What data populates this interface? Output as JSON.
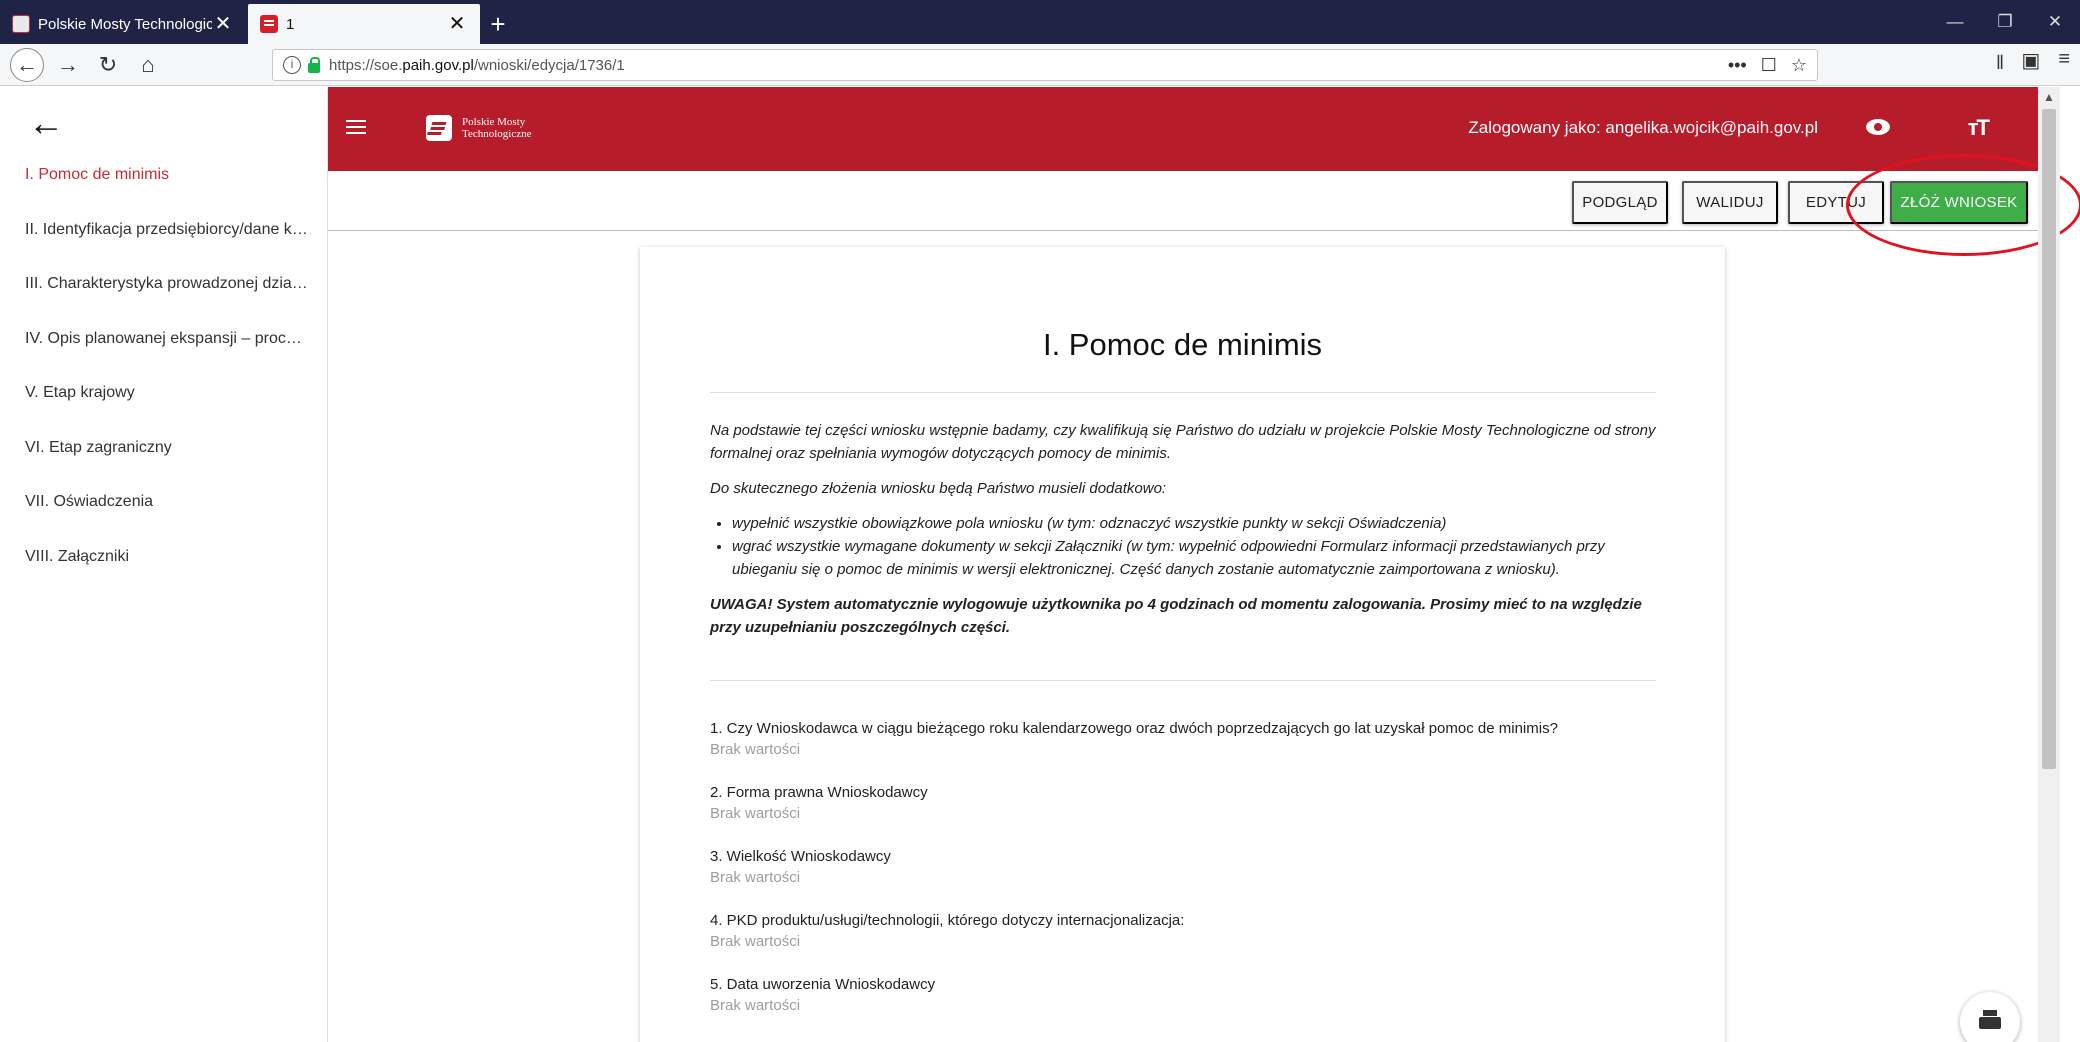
{
  "browser": {
    "tabs": [
      {
        "title": "Polskie Mosty Technologiczne |",
        "close": "✕"
      },
      {
        "title": "1",
        "close": "✕"
      }
    ],
    "new_tab": "+",
    "window_controls": [
      "—",
      "❐",
      "✕"
    ],
    "url_prefix": "https://soe.",
    "url_domain": "paih.gov.pl",
    "url_path": "/wnioski/edycja/1736/1",
    "url_actions": [
      "•••",
      "☐",
      "☆"
    ],
    "right_toolbar": [
      "𝍪",
      "▣",
      "≡"
    ]
  },
  "sidebar": {
    "back_icon": "←",
    "items": [
      {
        "label": "I. Pomoc de minimis"
      },
      {
        "label": "II. Identyfikacja przedsiębiorcy/dane kont..."
      },
      {
        "label": "III. Charakterystyka prowadzonej działaln..."
      },
      {
        "label": "IV. Opis planowanej ekspansji – proces in..."
      },
      {
        "label": "V. Etap krajowy"
      },
      {
        "label": "VI. Etap zagraniczny"
      },
      {
        "label": "VII. Oświadczenia"
      },
      {
        "label": "VIII. Załączniki"
      }
    ]
  },
  "header": {
    "logo_line1": "Polskie Mosty",
    "logo_line2": "Technologiczne",
    "user": "Zalogowany jako: angelika.wojcik@paih.gov.pl",
    "textsize_glyph": "тT",
    "brand_color": "#b71c2b"
  },
  "toolbar": {
    "preview": "PODGLĄD",
    "validate": "WALIDUJ",
    "edit": "EDYTUJ",
    "submit": "ZŁÓŻ WNIOSEK",
    "submit_color": "#3fae49"
  },
  "document": {
    "title": "I. Pomoc de minimis",
    "intro1": "Na podstawie tej części wniosku wstępnie badamy, czy kwalifikują się Państwo do udziału w projekcie Polskie Mosty Technologiczne od strony formalnej oraz spełniania wymogów dotyczących pomocy de minimis.",
    "intro2": "Do skutecznego złożenia wniosku będą Państwo musieli dodatkowo:",
    "bullets": [
      "wypełnić wszystkie obowiązkowe pola wniosku (w tym: odznaczyć wszystkie punkty w sekcji Oświadczenia)",
      "wgrać wszystkie wymagane dokumenty w sekcji Załączniki (w tym: wypełnić odpowiedni Formularz informacji przedstawianych przy ubieganiu się o pomoc de minimis w wersji elektronicznej. Część danych zostanie automatycznie zaimportowana z wniosku)."
    ],
    "warning": "UWAGA! System automatycznie wylogowuje użytkownika po 4 godzinach od momentu zalogowania. Prosimy mieć to na względzie przy uzupełnianiu poszczególnych części.",
    "questions": [
      {
        "label": "1.  Czy Wnioskodawca w ciągu bieżącego roku kalendarzowego oraz dwóch poprzedzających go lat uzyskał pomoc de minimis?",
        "value": "Brak wartości"
      },
      {
        "label": "2.  Forma prawna Wnioskodawcy",
        "value": "Brak wartości"
      },
      {
        "label": "3.  Wielkość Wnioskodawcy",
        "value": "Brak wartości"
      },
      {
        "label": "4.  PKD produktu/usługi/technologii, którego dotyczy internacjonalizacja:",
        "value": "Brak wartości"
      },
      {
        "label": "5.  Data uworzenia Wnioskodawcy",
        "value": "Brak wartości"
      }
    ]
  },
  "annotation_color": "#e2121c"
}
